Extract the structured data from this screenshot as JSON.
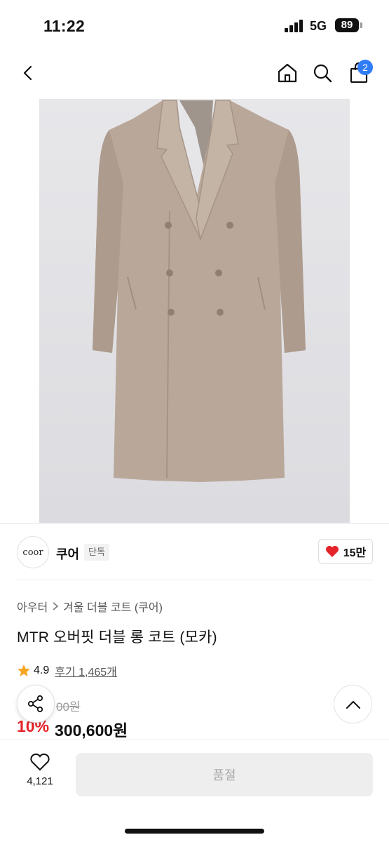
{
  "status_bar": {
    "time": "11:22",
    "network": "5G",
    "battery": "89"
  },
  "nav": {
    "cart_count": "2"
  },
  "brand": {
    "logo_text": "coor",
    "name": "쿠어",
    "badge": "단독",
    "likes": "15만"
  },
  "breadcrumb": {
    "category": "아우터",
    "subcategory": "겨울 더블 코트 (쿠어)"
  },
  "product": {
    "title": "MTR 오버핏 더블 롱 코트 (모카)",
    "rating": "4.9",
    "reviews": "후기 1,465개",
    "original_price": "00원",
    "discount": "10%",
    "price": "300,600원"
  },
  "bottom_bar": {
    "wish_count": "4,121",
    "soldout_label": "품절"
  },
  "colors": {
    "accent_blue": "#2f7cf6",
    "discount_red": "#e4242a",
    "coat": "#b9a89a"
  }
}
